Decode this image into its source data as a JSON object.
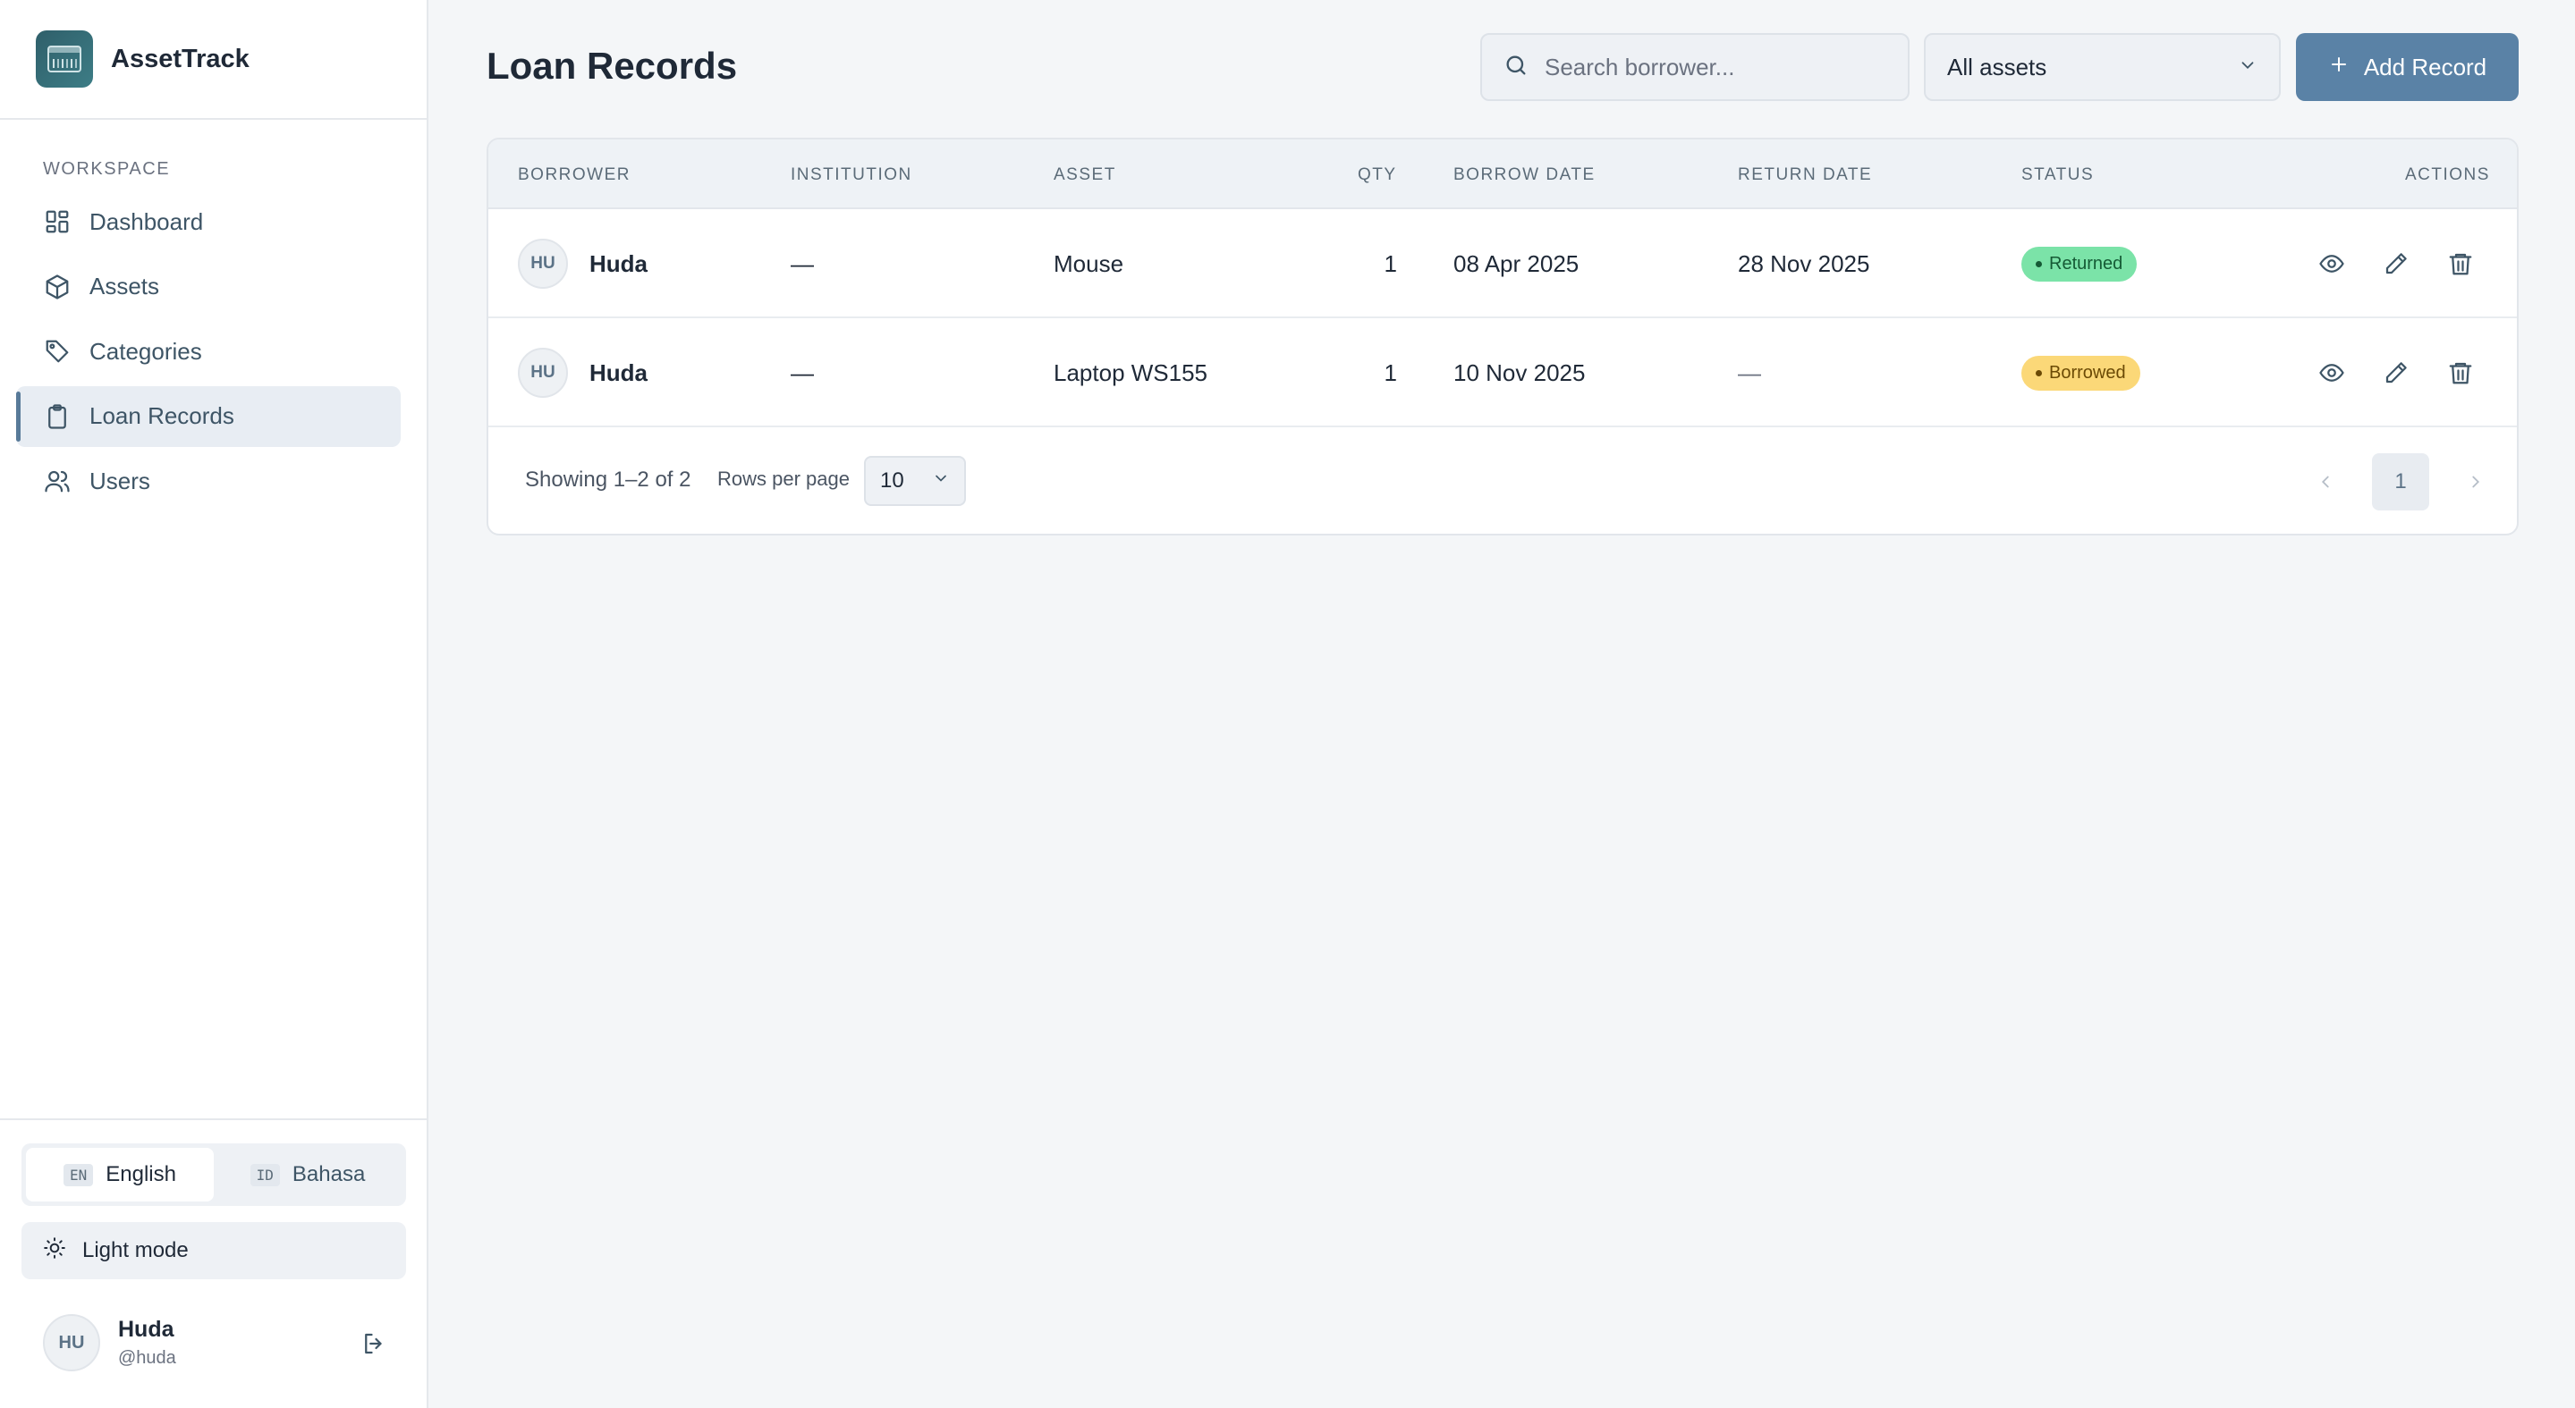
{
  "app": {
    "name": "AssetTrack"
  },
  "sidebar": {
    "section_label": "WORKSPACE",
    "items": [
      {
        "label": "Dashboard",
        "icon": "grid-icon"
      },
      {
        "label": "Assets",
        "icon": "box-icon"
      },
      {
        "label": "Categories",
        "icon": "tag-icon"
      },
      {
        "label": "Loan Records",
        "icon": "clipboard-icon",
        "active": true
      },
      {
        "label": "Users",
        "icon": "users-icon"
      }
    ],
    "languages": [
      {
        "code": "EN",
        "label": "English",
        "active": true
      },
      {
        "code": "ID",
        "label": "Bahasa"
      }
    ],
    "theme_label": "Light mode",
    "user": {
      "initials": "HU",
      "name": "Huda",
      "handle": "@huda"
    }
  },
  "header": {
    "title": "Loan Records",
    "search_placeholder": "Search borrower...",
    "filter_value": "All assets",
    "add_label": "Add Record"
  },
  "table": {
    "columns": [
      "BORROWER",
      "INSTITUTION",
      "ASSET",
      "QTY",
      "BORROW DATE",
      "RETURN DATE",
      "STATUS",
      "ACTIONS"
    ],
    "rows": [
      {
        "initials": "HU",
        "borrower": "Huda",
        "institution": "—",
        "asset": "Mouse",
        "qty": "1",
        "borrow_date": "08 Apr 2025",
        "return_date": "28 Nov 2025",
        "status": "Returned"
      },
      {
        "initials": "HU",
        "borrower": "Huda",
        "institution": "—",
        "asset": "Laptop WS155",
        "qty": "1",
        "borrow_date": "10 Nov 2025",
        "return_date": "—",
        "status": "Borrowed"
      }
    ],
    "footer": {
      "showing": "Showing 1–2 of 2",
      "rows_per_page_label": "Rows per page",
      "rows_per_page_value": "10",
      "current_page": "1"
    }
  },
  "colors": {
    "accent": "#5a82a6",
    "returned_badge": "#7be3a8",
    "borrowed_badge": "#fbd878"
  }
}
